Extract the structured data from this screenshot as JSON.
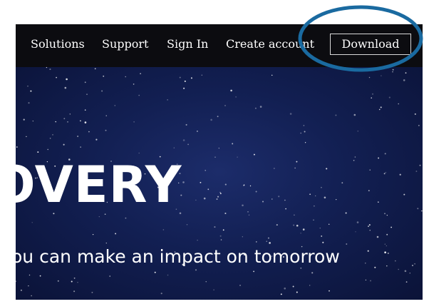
{
  "nav": {
    "solutions_label": "Solutions",
    "support_label": "Support",
    "sign_in_label": "Sign In",
    "create_account_label": "Create account",
    "download_label": "Download"
  },
  "hero": {
    "title": "OVERY",
    "subtitle": "ou can make an impact on tomorrow"
  },
  "colors": {
    "navbar_bg": "#0c0c10",
    "hero_bg": "#121f52",
    "highlight_ring": "#1a6aa0",
    "text": "#ffffff"
  }
}
